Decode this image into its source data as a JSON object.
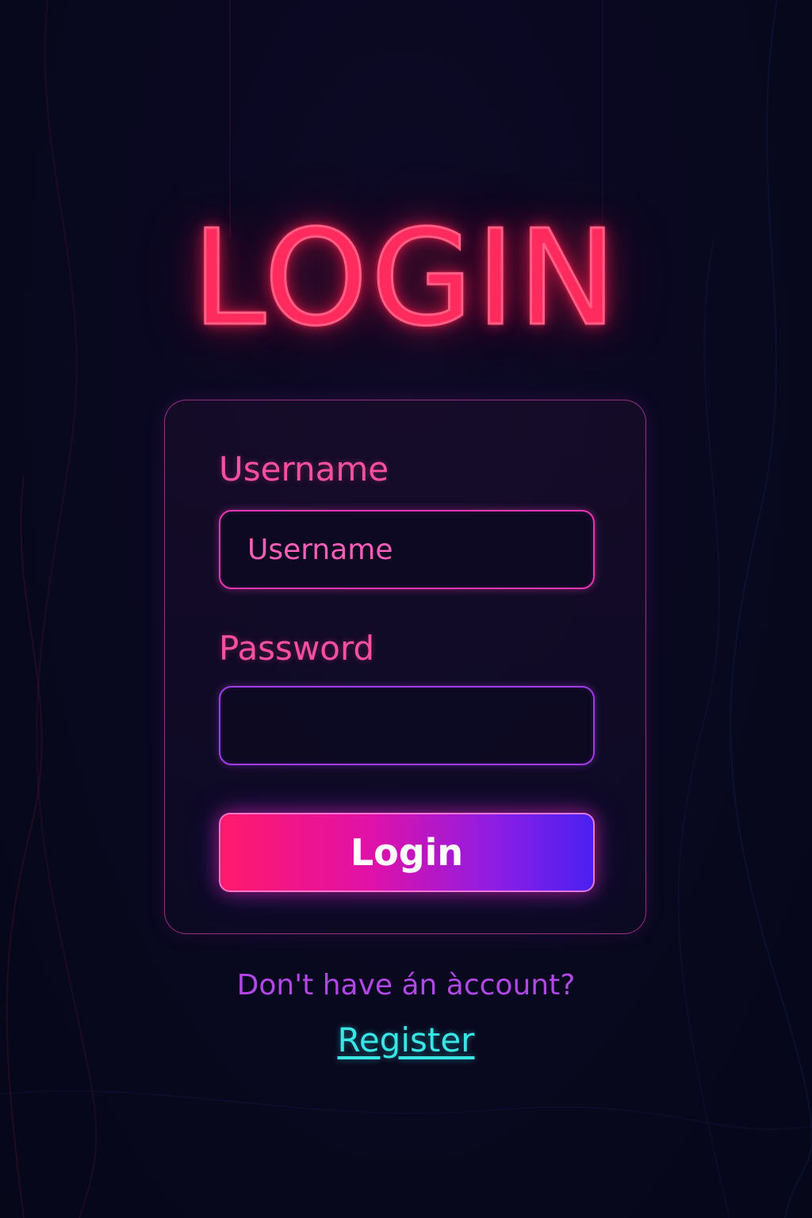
{
  "screen": {
    "title": "LOGIN"
  },
  "form": {
    "username_label": "Username",
    "username_placeholder": "Username",
    "username_value": "",
    "password_label": "Password",
    "password_value": "",
    "submit_label": "Login"
  },
  "footer": {
    "prompt": "Don't have án àccount?",
    "register_label": "Register"
  },
  "colors": {
    "title_neon": "#ff2a5e",
    "label_pink": "#ff4fa0",
    "button_gradient_start": "#ff1a6b",
    "button_gradient_end": "#4a20f0",
    "prompt_purple": "#b047e6",
    "link_cyan": "#38e6e6"
  }
}
